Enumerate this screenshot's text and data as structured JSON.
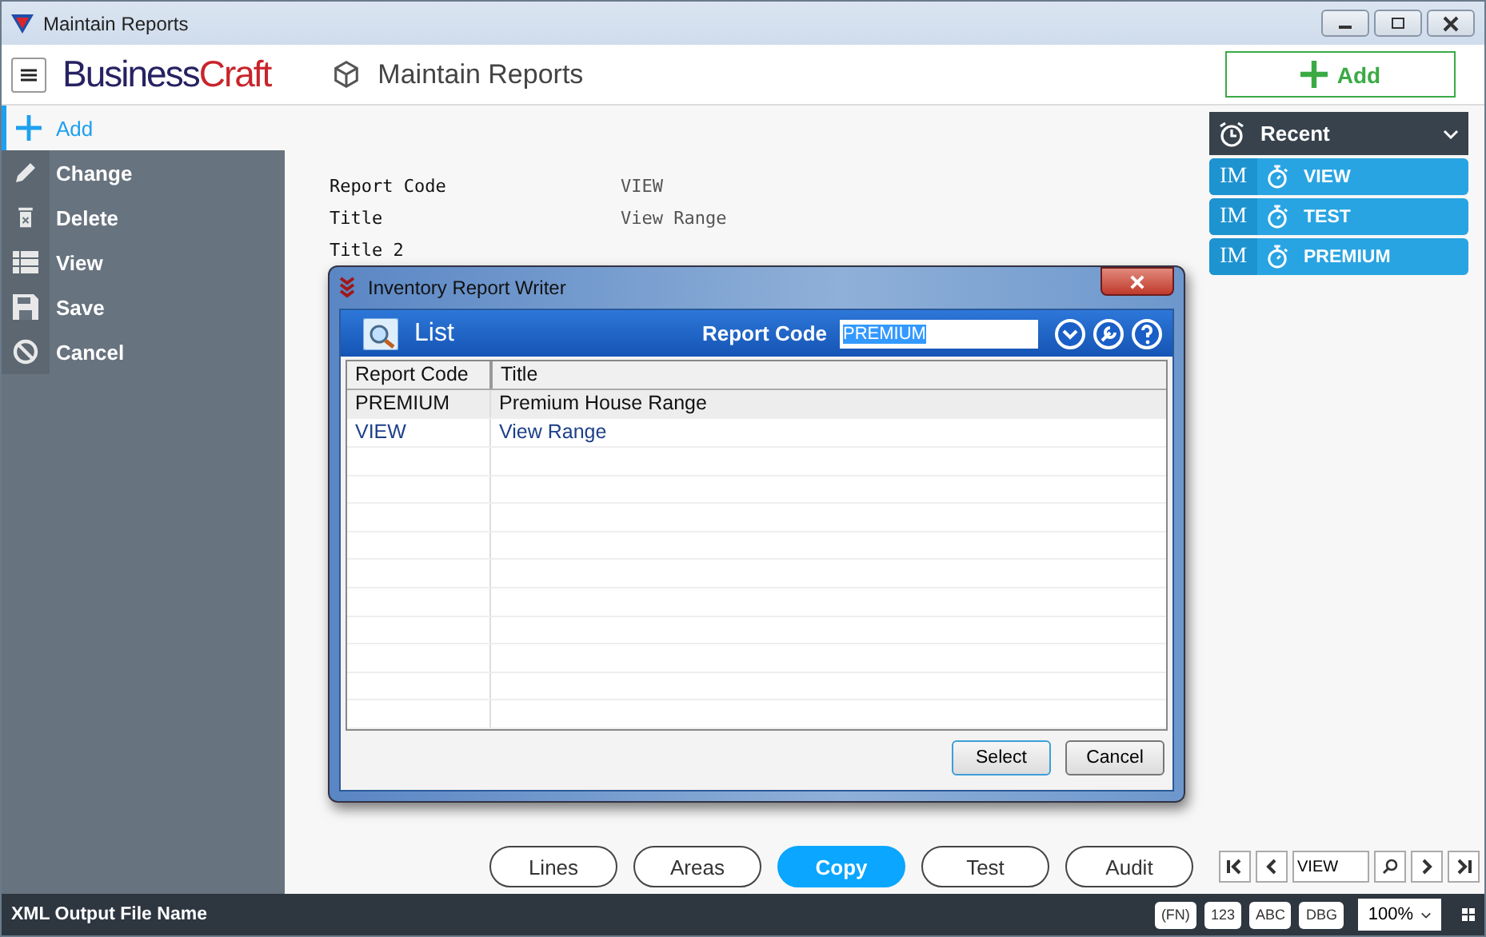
{
  "window": {
    "title": "Maintain Reports"
  },
  "header": {
    "logo_dark": "Business",
    "logo_red": "Craft",
    "title": "Maintain Reports",
    "add_button": "Add"
  },
  "sidebar": {
    "items": [
      {
        "label": "Add",
        "selected": true
      },
      {
        "label": "Change",
        "selected": false
      },
      {
        "label": "Delete",
        "selected": false
      },
      {
        "label": "View",
        "selected": false
      },
      {
        "label": "Save",
        "selected": false
      },
      {
        "label": "Cancel",
        "selected": false
      }
    ]
  },
  "fields": [
    {
      "label": "Report Code",
      "value": "VIEW"
    },
    {
      "label": "Title",
      "value": "View Range"
    },
    {
      "label": "Title 2"
    }
  ],
  "recent": {
    "title": "Recent",
    "expanded": true,
    "items": [
      {
        "prefix": "IM",
        "label": "VIEW"
      },
      {
        "prefix": "IM",
        "label": "TEST"
      },
      {
        "prefix": "IM",
        "label": "PREMIUM"
      }
    ]
  },
  "dialog": {
    "title": "Inventory Report Writer",
    "list_title": "List",
    "search_label": "Report Code",
    "search_value": "PREMIUM",
    "columns": [
      "Report Code",
      "Title"
    ],
    "rows": [
      {
        "code": "PREMIUM",
        "title": "Premium House Range",
        "selected": true
      },
      {
        "code": "VIEW",
        "title": "View Range",
        "selected": false
      }
    ],
    "buttons": [
      "Select",
      "Cancel"
    ]
  },
  "actions": [
    {
      "label": "Lines",
      "selected": false
    },
    {
      "label": "Areas",
      "selected": false
    },
    {
      "label": "Copy",
      "selected": true
    },
    {
      "label": "Test",
      "selected": false
    },
    {
      "label": "Audit",
      "selected": false
    }
  ],
  "navigator": {
    "value": "VIEW"
  },
  "status_bar": {
    "text": "XML Output File Name",
    "badges": [
      "(FN)",
      "123",
      "ABC",
      "DBG"
    ],
    "zoom": "100%"
  }
}
